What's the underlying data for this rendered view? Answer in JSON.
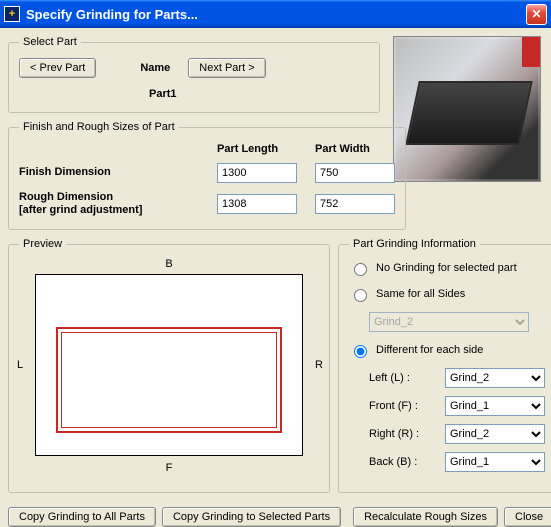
{
  "window": {
    "title": "Specify Grinding for Parts...",
    "icon_glyph": "+"
  },
  "selectPart": {
    "legend": "Select Part",
    "prev": "< Prev Part",
    "next": "Next Part >",
    "nameLabel": "Name",
    "nameValue": "Part1"
  },
  "sizes": {
    "legend": "Finish and Rough Sizes of Part",
    "colLength": "Part Length",
    "colWidth": "Part Width",
    "rowFinish": "Finish Dimension",
    "rowRough": "Rough Dimension\n[after grind adjustment]",
    "finishLength": "1300",
    "finishWidth": "750",
    "roughLength": "1308",
    "roughWidth": "752"
  },
  "preview": {
    "legend": "Preview",
    "B": "B",
    "F": "F",
    "L": "L",
    "R": "R"
  },
  "info": {
    "legend": "Part Grinding Information",
    "optNone": "No Grinding for selected part",
    "optSame": "Same for all Sides",
    "sameValue": "Grind_2",
    "optDiff": "Different for each side",
    "leftLabel": "Left (L) :",
    "frontLabel": "Front (F) :",
    "rightLabel": "Right (R) :",
    "backLabel": "Back (B) :",
    "leftValue": "Grind_2",
    "frontValue": "Grind_1",
    "rightValue": "Grind_2",
    "backValue": "Grind_1",
    "options": [
      "Grind_1",
      "Grind_2"
    ]
  },
  "buttons": {
    "copyAll": "Copy Grinding to All Parts",
    "copySel": "Copy Grinding to Selected Parts",
    "recalc": "Recalculate Rough Sizes",
    "close": "Close"
  }
}
